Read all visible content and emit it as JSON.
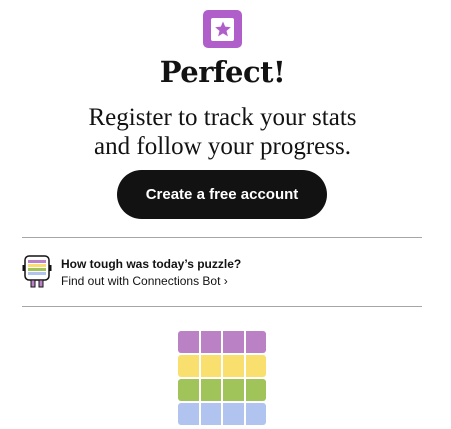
{
  "colors": {
    "badge": "#b05ec9",
    "button_bg": "#121212",
    "purple": "#ba81c5",
    "yellow": "#f9df6d",
    "green": "#a0c35a",
    "blue": "#b0c4ef"
  },
  "header": {
    "badge_icon": "star-icon",
    "title": "Perfect!"
  },
  "register": {
    "line1": "Register to track your stats",
    "line2": "and follow your progress.",
    "button_label": "Create a free account"
  },
  "bot": {
    "icon": "connections-bot-icon",
    "question": "How tough was today’s puzzle?",
    "link": "Find out with Connections Bot ›"
  },
  "result_grid": {
    "rows": [
      "purple",
      "yellow",
      "green",
      "blue"
    ],
    "columns": 4
  }
}
